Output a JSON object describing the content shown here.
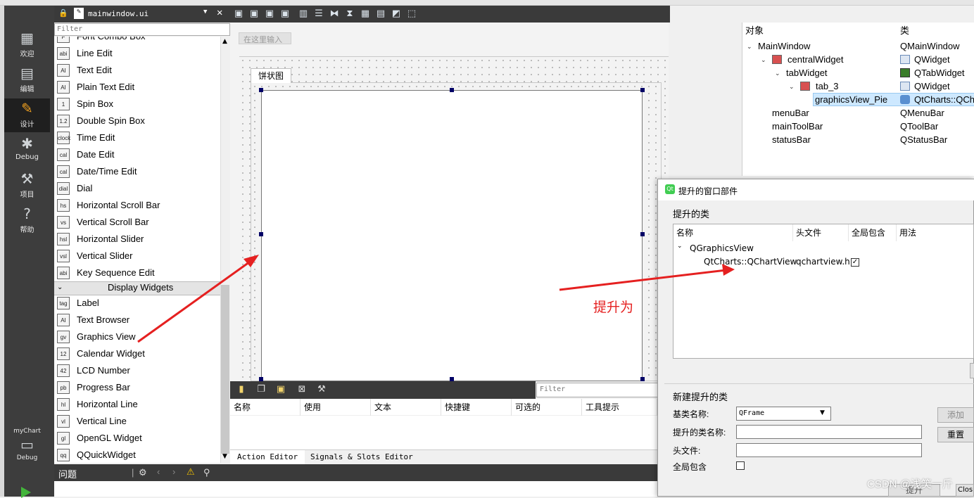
{
  "window": {
    "file_name": "mainwindow.ui"
  },
  "mode_bar": {
    "modes": [
      {
        "label": "欢迎",
        "icon": "grid-icon"
      },
      {
        "label": "编辑",
        "icon": "document-icon"
      },
      {
        "label": "设计",
        "icon": "pencil-icon"
      },
      {
        "label": "Debug",
        "icon": "bug-icon"
      },
      {
        "label": "项目",
        "icon": "wrench-icon"
      },
      {
        "label": "帮助",
        "icon": "help-icon"
      }
    ],
    "kit": {
      "name": "myChart",
      "build": "Debug"
    },
    "active": "设计"
  },
  "widget_box": {
    "filter_placeholder": "Filter",
    "partial_top_item": "Font Combo Box",
    "input_items": [
      {
        "label": "Line Edit",
        "icon": "abi"
      },
      {
        "label": "Text Edit",
        "icon": "AI"
      },
      {
        "label": "Plain Text Edit",
        "icon": "AI"
      },
      {
        "label": "Spin Box",
        "icon": "1"
      },
      {
        "label": "Double Spin Box",
        "icon": "1.2"
      },
      {
        "label": "Time Edit",
        "icon": "clock"
      },
      {
        "label": "Date Edit",
        "icon": "cal"
      },
      {
        "label": "Date/Time Edit",
        "icon": "cal"
      },
      {
        "label": "Dial",
        "icon": "dial"
      },
      {
        "label": "Horizontal Scroll Bar",
        "icon": "hs"
      },
      {
        "label": "Vertical Scroll Bar",
        "icon": "vs"
      },
      {
        "label": "Horizontal Slider",
        "icon": "hsl"
      },
      {
        "label": "Vertical Slider",
        "icon": "vsl"
      },
      {
        "label": "Key Sequence Edit",
        "icon": "abi"
      }
    ],
    "display_category": "Display Widgets",
    "display_items": [
      {
        "label": "Label",
        "icon": "tag"
      },
      {
        "label": "Text Browser",
        "icon": "AI"
      },
      {
        "label": "Graphics View",
        "icon": "gv"
      },
      {
        "label": "Calendar Widget",
        "icon": "12"
      },
      {
        "label": "LCD Number",
        "icon": "42"
      },
      {
        "label": "Progress Bar",
        "icon": "pb"
      },
      {
        "label": "Horizontal Line",
        "icon": "hl"
      },
      {
        "label": "Vertical Line",
        "icon": "vl"
      },
      {
        "label": "OpenGL Widget",
        "icon": "gl"
      },
      {
        "label": "QQuickWidget",
        "icon": "qq"
      }
    ]
  },
  "form": {
    "menu_placeholder": "在这里输入",
    "tab_label": "饼状图"
  },
  "issues_bar": {
    "label": "问题"
  },
  "action_editor": {
    "filter_placeholder": "Filter",
    "columns": [
      "名称",
      "使用",
      "文本",
      "快捷键",
      "可选的",
      "工具提示"
    ],
    "tabs": [
      "Action Editor",
      "Signals & Slots Editor"
    ]
  },
  "object_inspector": {
    "headers": [
      "对象",
      "类"
    ],
    "rows": [
      {
        "name": "MainWindow",
        "class": "QMainWindow"
      },
      {
        "name": "centralWidget",
        "class": "QWidget"
      },
      {
        "name": "tabWidget",
        "class": "QTabWidget"
      },
      {
        "name": "tab_3",
        "class": "QWidget"
      },
      {
        "name": "graphicsView_Pie",
        "class": "QtCharts::QCha"
      },
      {
        "name": "menuBar",
        "class": "QMenuBar"
      },
      {
        "name": "mainToolBar",
        "class": "QToolBar"
      },
      {
        "name": "statusBar",
        "class": "QStatusBar"
      }
    ],
    "selected": "graphicsView_Pie"
  },
  "promote_dialog": {
    "title": "提升的窗口部件",
    "promoted_group": "提升的类",
    "columns": [
      "名称",
      "头文件",
      "全局包含",
      "用法"
    ],
    "base_class": "QGraphicsView",
    "promoted_class": "QtCharts::QChartView",
    "header_file": "qchartview.h",
    "global_include_checked": true,
    "new_group": "新建提升的类",
    "base_name_label": "基类名称:",
    "base_name_value": "QFrame",
    "class_name_label": "提升的类名称:",
    "header_label": "头文件:",
    "global_label": "全局包含",
    "add_button": "添加",
    "reset_button": "重置",
    "promote_button": "提升",
    "close_button": "Clos"
  },
  "annotation": {
    "label": "提升为",
    "color": "#e52020"
  },
  "watermark": "CSDN @浅笑一斤"
}
